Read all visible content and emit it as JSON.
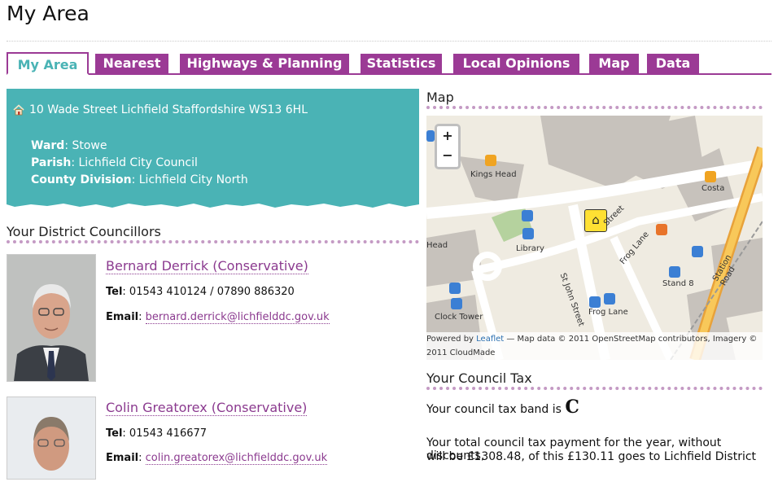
{
  "page": {
    "title": "My Area"
  },
  "tabs": [
    {
      "label": "My Area",
      "active": true
    },
    {
      "label": "Nearest"
    },
    {
      "label": "Highways & Planning"
    },
    {
      "label": "Statistics"
    },
    {
      "label": "Local Opinions"
    },
    {
      "label": "Map"
    },
    {
      "label": "Data"
    }
  ],
  "address": {
    "line": "10 Wade Street Lichfield Staffordshire WS13 6HL",
    "ward_label": "Ward",
    "ward": ": Stowe",
    "parish_label": "Parish",
    "parish": ": Lichfield City Council",
    "county_label": "County Division",
    "county": ": Lichfield City North"
  },
  "councillors": {
    "heading": "Your District Councillors",
    "items": [
      {
        "name": "Bernard Derrick (Conservative)",
        "tel_label": "Tel",
        "tel": ": 01543 410124 / 07890 886320",
        "email_label": "Email",
        "email": "bernard.derrick@lichfielddc.gov.uk"
      },
      {
        "name": "Colin Greatorex (Conservative)",
        "tel_label": "Tel",
        "tel": ": 01543 416677",
        "email_label": "Email",
        "email": "colin.greatorex@lichfielddc.gov.uk"
      }
    ]
  },
  "map": {
    "heading": "Map",
    "zoom_in": "+",
    "zoom_out": "−",
    "labels": [
      "Kings Head",
      "Costa",
      "Library",
      "Head",
      "St John Street",
      "Frog Lane",
      "Stand 8",
      "Station Road",
      "Clock Tower",
      "Frog Lane",
      "Street"
    ],
    "attr_prefix": "Powered by ",
    "attr_link": "Leaflet",
    "attr_rest": " — Map data © 2011 OpenStreetMap contributors, Imagery © 2011 CloudMade"
  },
  "tax": {
    "heading": "Your Council Tax",
    "band_prefix": "Your council tax band is ",
    "band": "C",
    "para_line1": "Your total council tax payment for the year, without discounts,",
    "para_line2": "will be £1308.48, of this £130.11 goes to Lichfield District"
  },
  "colors": {
    "purple": "#9b3a95",
    "teal": "#4ab3b5"
  }
}
